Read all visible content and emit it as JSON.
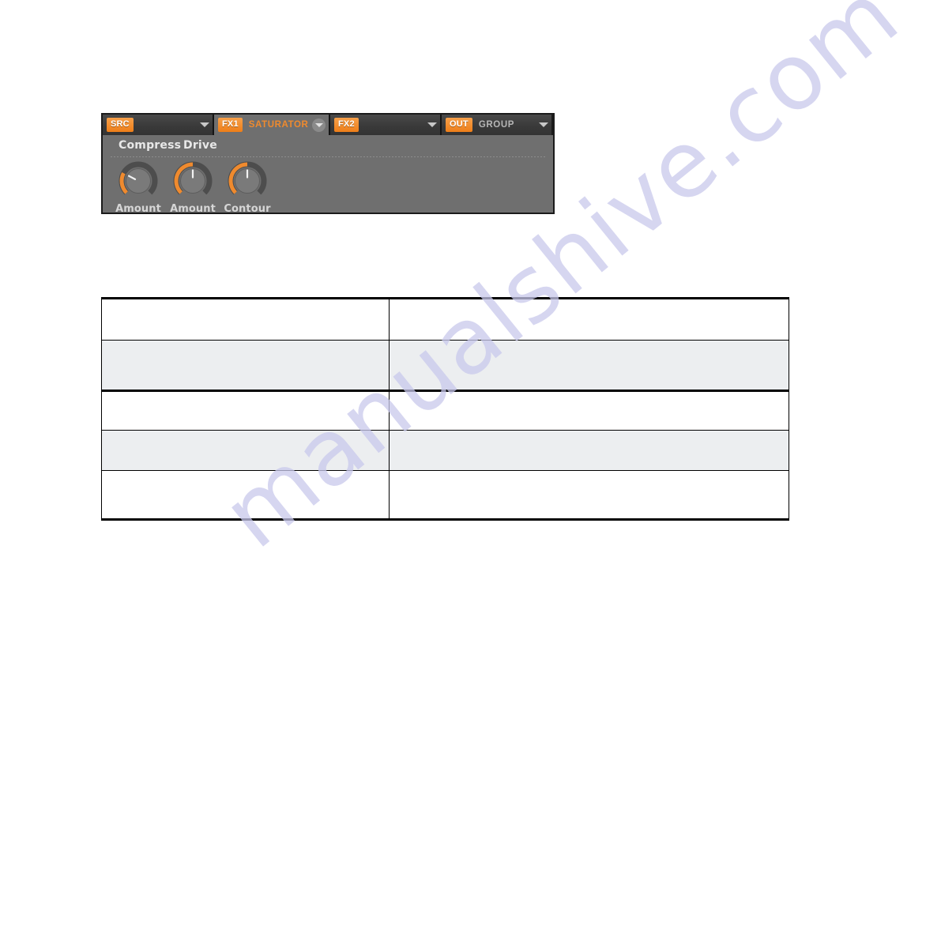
{
  "plugin": {
    "name": "saturator-plugin-strip",
    "tabs": [
      {
        "badge": "SRC",
        "label": "",
        "active": false,
        "arrow": "chevron-down-icon"
      },
      {
        "badge": "FX1",
        "label": "SATURATOR",
        "active": true,
        "arrow": "chevron-down-icon"
      },
      {
        "badge": "FX2",
        "label": "",
        "active": false,
        "arrow": "chevron-down-icon"
      },
      {
        "badge": "OUT",
        "label": "GROUP",
        "active": false,
        "arrow": "chevron-down-icon"
      }
    ],
    "sections": [
      {
        "title": "Compress"
      },
      {
        "title": "Drive"
      }
    ],
    "knobs": [
      {
        "label": "Amount",
        "section": "Compress",
        "value_angle_deg": -62,
        "arc_start_deg": -135,
        "arc_end_deg": -62,
        "style": "pointer-line"
      },
      {
        "label": "Amount",
        "section": "Drive",
        "value_angle_deg": 0,
        "arc_start_deg": -135,
        "arc_end_deg": 0,
        "style": "pointer-line"
      },
      {
        "label": "Contour",
        "section": "Drive",
        "value_angle_deg": 0,
        "arc_start_deg": -135,
        "arc_end_deg": 0,
        "style": "pointer-line"
      }
    ],
    "colors": {
      "accent_orange": "#ef8a2e",
      "badge_orange": "#f0862a",
      "panel_grey": "#6f6f6f",
      "tab_grey": "#3a3a3a",
      "frame_black": "#1b1b1b",
      "knob_body": "#7a7a7a",
      "knob_ring": "#4d4d4d",
      "label_grey": "#d6d6d6"
    }
  },
  "table": {
    "name": "parameter-description-table",
    "columns": [
      "",
      ""
    ],
    "rows": [
      {
        "shade": "white",
        "cells": [
          "",
          ""
        ]
      },
      {
        "shade": "grey",
        "cells": [
          "",
          ""
        ]
      },
      {
        "shade": "white",
        "cells": [
          "",
          ""
        ]
      },
      {
        "shade": "grey",
        "cells": [
          "",
          ""
        ]
      },
      {
        "shade": "white",
        "cells": [
          "",
          ""
        ]
      }
    ]
  },
  "watermark": {
    "text": "manualshive.com",
    "color": "#c9c9ec"
  }
}
